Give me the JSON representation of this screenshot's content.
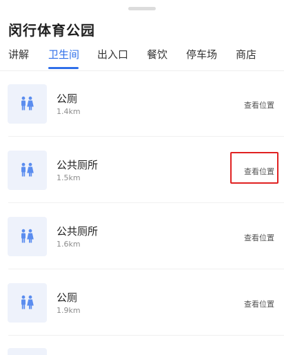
{
  "sheet": {
    "title": "闵行体育公园"
  },
  "tabs": [
    {
      "label": "讲解",
      "active": false
    },
    {
      "label": "卫生间",
      "active": true
    },
    {
      "label": "出入口",
      "active": false
    },
    {
      "label": "餐饮",
      "active": false
    },
    {
      "label": "停车场",
      "active": false
    },
    {
      "label": "商店",
      "active": false
    }
  ],
  "results": [
    {
      "name": "公厕",
      "distance": "1.4km",
      "action": "查看位置",
      "icon": "restroom-icon"
    },
    {
      "name": "公共厕所",
      "distance": "1.5km",
      "action": "查看位置",
      "icon": "restroom-icon",
      "highlighted": true
    },
    {
      "name": "公共厕所",
      "distance": "1.6km",
      "action": "查看位置",
      "icon": "restroom-icon"
    },
    {
      "name": "公厕",
      "distance": "1.9km",
      "action": "查看位置",
      "icon": "restroom-icon"
    }
  ],
  "colors": {
    "accent": "#2f6fe9",
    "icon_tint": "#5b8def",
    "thumb_bg": "#eef2fb",
    "highlight": "#e02020"
  }
}
